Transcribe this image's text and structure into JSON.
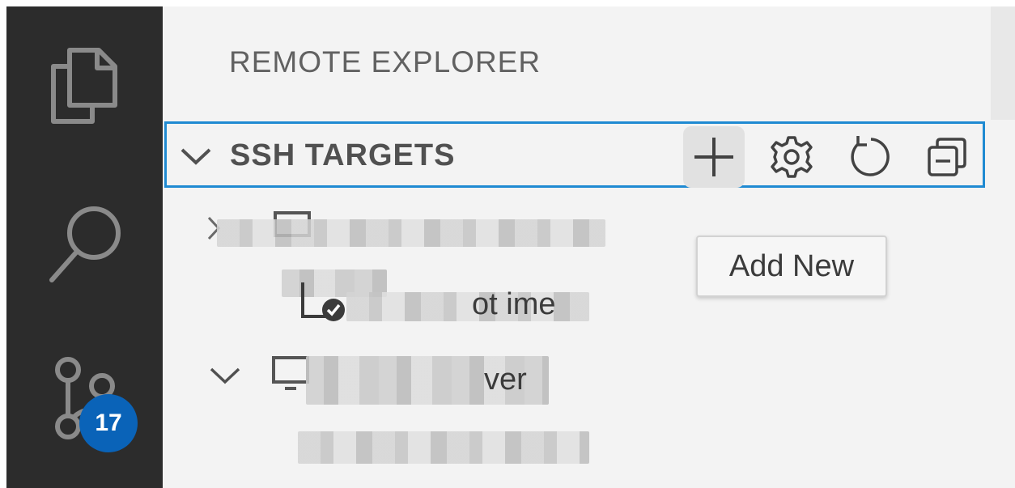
{
  "activity_bar": {
    "items": [
      {
        "name": "explorer",
        "icon": "files-icon"
      },
      {
        "name": "search",
        "icon": "search-icon"
      },
      {
        "name": "source-control",
        "icon": "source-control-icon",
        "badge": "17"
      }
    ],
    "badge_color": "#0a63b8"
  },
  "sidebar": {
    "title": "REMOTE EXPLORER",
    "section": {
      "title": "SSH TARGETS",
      "actions": [
        {
          "name": "add-new",
          "icon": "plus-icon",
          "tooltip": "Add New"
        },
        {
          "name": "configure",
          "icon": "gear-icon"
        },
        {
          "name": "refresh",
          "icon": "refresh-icon"
        },
        {
          "name": "collapse-all",
          "icon": "collapse-all-icon"
        }
      ]
    },
    "tree": [
      {
        "text_visible": "ot ime"
      },
      {
        "text_visible": "ver"
      }
    ]
  },
  "tooltip": {
    "text": "Add New"
  },
  "colors": {
    "accent_border": "#1f8ad2",
    "activity_bar_bg": "#2c2c2c",
    "sidebar_bg": "#f3f3f3"
  }
}
